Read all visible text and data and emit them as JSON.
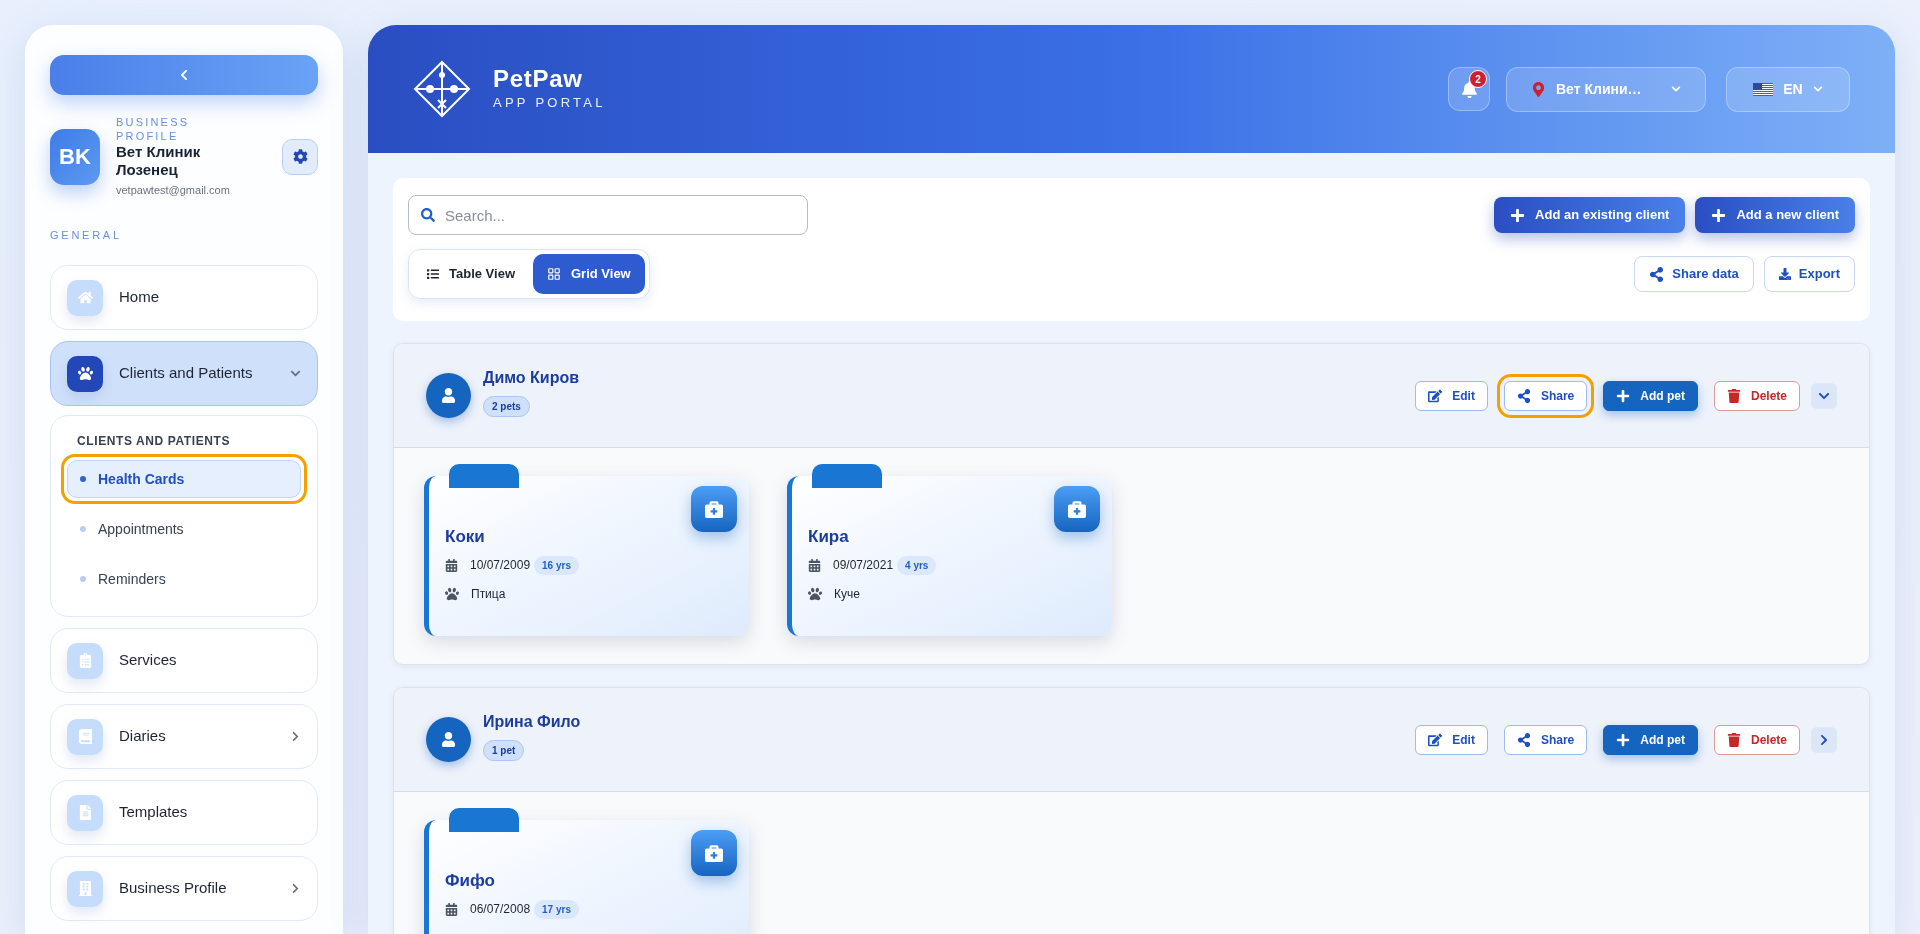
{
  "sidebar": {
    "profile": {
      "initials": "BK",
      "label": "BUSINESS PROFILE",
      "name": "Вет Клиник Лозенец",
      "email": "vetpawtest@gmail.com"
    },
    "section_label": "GENERAL",
    "nav": [
      {
        "label": "Home",
        "selected": false
      },
      {
        "label": "Clients and Patients",
        "selected": true,
        "expanded": true,
        "submenu": {
          "title": "CLIENTS AND PATIENTS",
          "items": [
            {
              "label": "Health Cards",
              "selected": true,
              "highlighted": true
            },
            {
              "label": "Appointments",
              "selected": false,
              "highlighted": false
            },
            {
              "label": "Reminders",
              "selected": false,
              "highlighted": false
            }
          ]
        }
      },
      {
        "label": "Services",
        "selected": false
      },
      {
        "label": "Diaries",
        "selected": false,
        "expanded": false
      },
      {
        "label": "Templates",
        "selected": false
      },
      {
        "label": "Business Profile",
        "selected": false,
        "expanded": false
      }
    ]
  },
  "header": {
    "brand": "PetPaw",
    "subtitle": "APP PORTAL",
    "notifications": "2",
    "location": "Вет Клини…",
    "language": "EN"
  },
  "toolbar": {
    "search": {
      "placeholder": "Search..."
    },
    "views": [
      {
        "label": "Table View",
        "selected": false
      },
      {
        "label": "Grid View",
        "selected": true
      }
    ],
    "primary_buttons": [
      "Add an existing client",
      "Add a new client"
    ],
    "secondary_buttons": [
      {
        "kind": "share",
        "label": "Share data"
      },
      {
        "kind": "export",
        "label": "Export"
      }
    ]
  },
  "clients": [
    {
      "name": "Димо Киров",
      "pet_count": "2 pets",
      "expanded": true,
      "actions": [
        {
          "kind": "edit",
          "label": "Edit",
          "highlighted": false
        },
        {
          "kind": "share",
          "label": "Share",
          "highlighted": true
        },
        {
          "kind": "add",
          "label": "Add pet",
          "highlighted": false
        },
        {
          "kind": "delete",
          "label": "Delete",
          "highlighted": false
        }
      ],
      "pets": [
        {
          "name": "Коки",
          "birth_date": "10/07/2009",
          "age": "16 yrs",
          "species": "Птица"
        },
        {
          "name": "Кира",
          "birth_date": "09/07/2021",
          "age": "4 yrs",
          "species": "Куче"
        }
      ]
    },
    {
      "name": "Ирина Фило",
      "pet_count": "1 pet",
      "expanded": false,
      "actions": [
        {
          "kind": "edit",
          "label": "Edit",
          "highlighted": false
        },
        {
          "kind": "share",
          "label": "Share",
          "highlighted": false
        },
        {
          "kind": "add",
          "label": "Add pet",
          "highlighted": false
        },
        {
          "kind": "delete",
          "label": "Delete",
          "highlighted": false
        }
      ],
      "pets": [
        {
          "name": "Фифо",
          "birth_date": "06/07/2008",
          "age": "17 yrs"
        }
      ]
    }
  ]
}
